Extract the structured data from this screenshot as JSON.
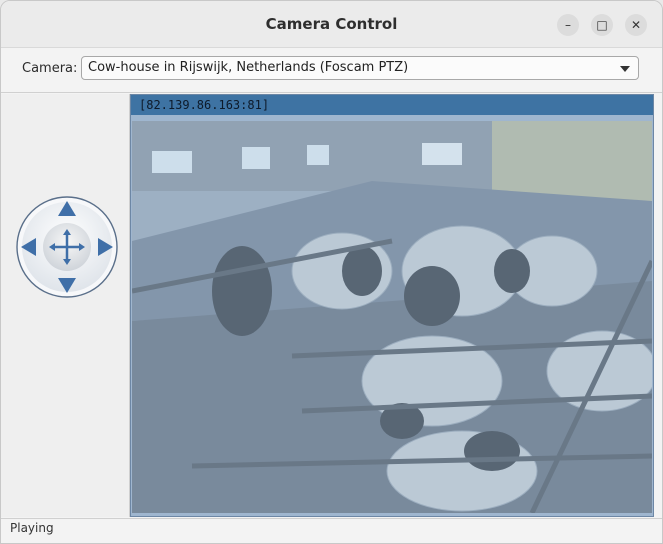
{
  "window": {
    "title": "Camera Control"
  },
  "camera_selector": {
    "label": "Camera:",
    "selected": "Cow-house in Rijswijk, Netherlands (Foscam PTZ)"
  },
  "video": {
    "address": "[82.139.86.163:81]",
    "scene": "cow-house video feed"
  },
  "ptz": {
    "icons": [
      "pan-up-icon",
      "pan-down-icon",
      "pan-left-icon",
      "pan-right-icon",
      "center-icon"
    ]
  },
  "status": {
    "text": "Playing"
  },
  "colors": {
    "ip_bar": "#3e73a3",
    "ptz_arrow": "#3f6fa8",
    "video_tint": "#9fb6cf"
  }
}
